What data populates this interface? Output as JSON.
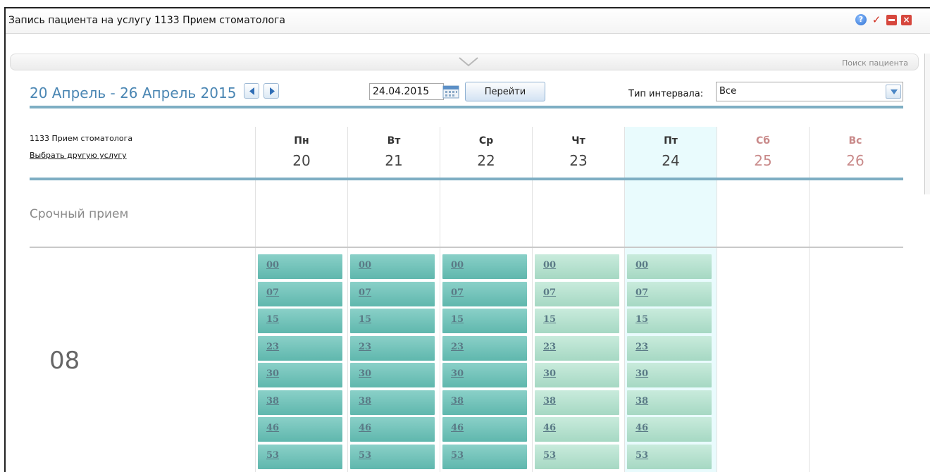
{
  "window": {
    "title": "Запись пациента на услугу 1133 Прием стоматолога"
  },
  "collapse_bar": {
    "search_link": "Поиск пациента"
  },
  "toolbar": {
    "week_range": "20 Апрель - 26 Апрель 2015",
    "date_value": "24.04.2015",
    "goto_label": "Перейти",
    "interval_label": "Тип интервала:",
    "interval_value": "Все"
  },
  "service": {
    "name": "1133 Прием стоматолога",
    "change_link": "Выбрать другую услугу"
  },
  "days": [
    {
      "name": "Пн",
      "num": "20"
    },
    {
      "name": "Вт",
      "num": "21"
    },
    {
      "name": "Ср",
      "num": "22"
    },
    {
      "name": "Чт",
      "num": "23"
    },
    {
      "name": "Пт",
      "num": "24"
    },
    {
      "name": "Сб",
      "num": "25"
    },
    {
      "name": "Вс",
      "num": "26"
    }
  ],
  "urgent_label": "Срочный прием",
  "hour": "08",
  "slots": [
    "00",
    "07",
    "15",
    "23",
    "30",
    "38",
    "46",
    "53"
  ],
  "colors": {
    "accent": "#4a86b3",
    "rule": "#7eaec3",
    "slot_dark": "#6fc0b6",
    "slot_light": "#b5dfcc",
    "today": "#e9fbfd"
  }
}
